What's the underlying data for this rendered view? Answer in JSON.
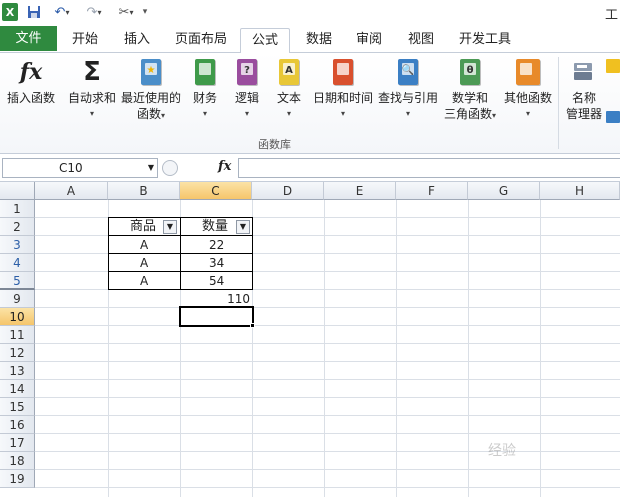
{
  "qat": {
    "save_icon": "save-icon",
    "undo_icon": "undo-icon",
    "redo_icon": "redo-icon",
    "tool_icon": "tools-icon"
  },
  "app_title": "工",
  "tabs": [
    "文件",
    "开始",
    "插入",
    "页面布局",
    "公式",
    "数据",
    "审阅",
    "视图",
    "开发工具"
  ],
  "active_tab": "公式",
  "ribbon": {
    "insert_function": "插入函数",
    "autosum": "自动求和",
    "recent_line1": "最近使用的",
    "recent_line2": "函数",
    "financial": "财务",
    "logical": "逻辑",
    "text": "文本",
    "datetime": "日期和时间",
    "lookup": "查找与引用",
    "math_line1": "数学和",
    "math_line2": "三角函数",
    "other": "其他函数",
    "name_line1": "名称",
    "name_line2": "管理器",
    "group_label": "函数库",
    "fx_symbol": "fx",
    "sigma_symbol": "Σ",
    "logical_glyph": "?",
    "text_glyph": "A",
    "math_glyph": "θ",
    "colors": {
      "financial": "#3f9a4a",
      "logical": "#9a4d9e",
      "text": "#e8c737",
      "datetime": "#d9502e",
      "lookup": "#3b7fc4",
      "math": "#4c9a55",
      "other": "#e88a2a",
      "recent": "#4a8ec9"
    }
  },
  "formula_bar": {
    "name_box": "C10",
    "fx": "fx",
    "value": ""
  },
  "columns": [
    "A",
    "B",
    "C",
    "D",
    "E",
    "F",
    "G",
    "H"
  ],
  "selected_column": "C",
  "rows": [
    "1",
    "2",
    "3",
    "4",
    "5",
    "9",
    "10",
    "11",
    "12",
    "13",
    "14",
    "15",
    "16",
    "17",
    "18",
    "19"
  ],
  "filtered_rows": [
    "3",
    "4",
    "5"
  ],
  "selected_row": "10",
  "table": {
    "header_b": "商品",
    "header_c": "数量",
    "rows": [
      {
        "b": "A",
        "c": "22"
      },
      {
        "b": "A",
        "c": "34"
      },
      {
        "b": "A",
        "c": "54"
      }
    ],
    "total": "110"
  },
  "watermark": "经验"
}
